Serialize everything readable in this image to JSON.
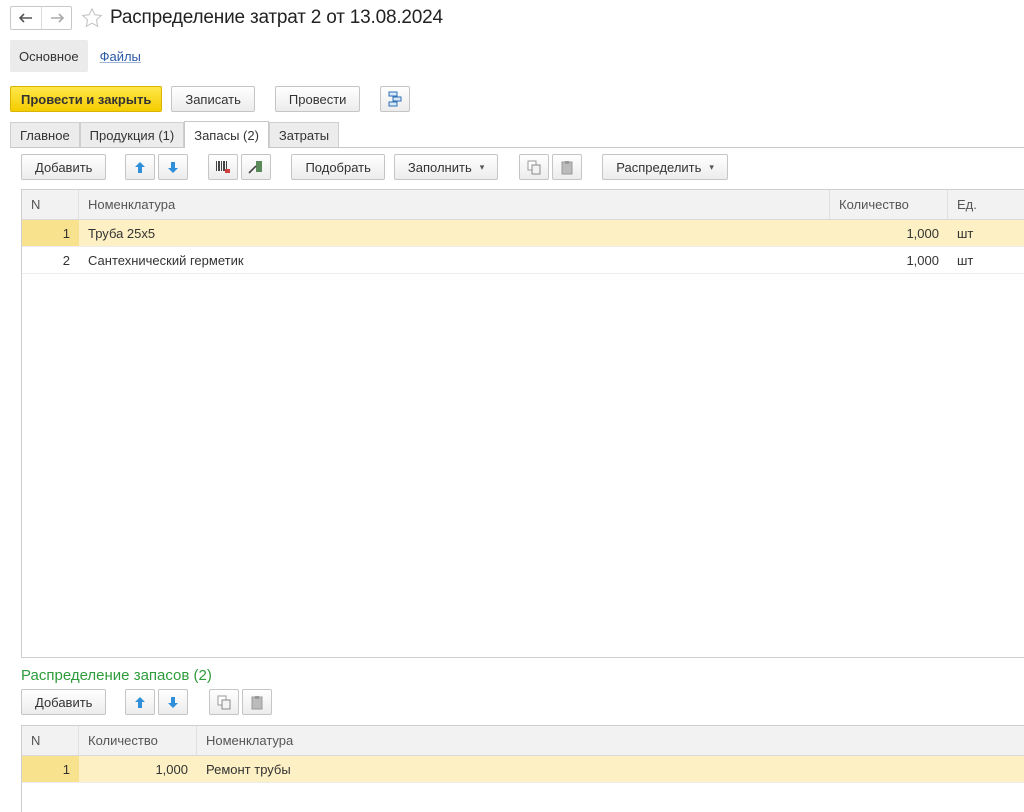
{
  "header": {
    "back_icon": "arrow-left",
    "forward_icon": "arrow-right",
    "favorite_icon": "star-outline",
    "title": "Распределение затрат 2 от 13.08.2024"
  },
  "sections": {
    "main": "Основное",
    "files": "Файлы"
  },
  "toolbar": {
    "post_close": "Провести и закрыть",
    "save": "Записать",
    "post": "Провести",
    "structure_icon": "document-structure"
  },
  "tabs": [
    {
      "label": "Главное"
    },
    {
      "label": "Продукция (1)"
    },
    {
      "label": "Запасы (2)",
      "active": true
    },
    {
      "label": "Затраты"
    }
  ],
  "stock_toolbar": {
    "add": "Добавить",
    "move_up_icon": "arrow-up",
    "move_down_icon": "arrow-down",
    "barcode_icon": "barcode",
    "scanner_icon": "scanner",
    "pick": "Подобрать",
    "fill": "Заполнить",
    "copy_icon": "copy",
    "paste_icon": "paste",
    "distribute": "Распределить"
  },
  "stock_table": {
    "columns": [
      "N",
      "Номенклатура",
      "Количество",
      "Ед."
    ],
    "rows": [
      {
        "n": "1",
        "item": "Труба 25х5",
        "qty": "1,000",
        "unit": "шт",
        "selected": true
      },
      {
        "n": "2",
        "item": "Сантехнический герметик",
        "qty": "1,000",
        "unit": "шт"
      }
    ]
  },
  "distribution": {
    "title": "Распределение запасов (2)",
    "add": "Добавить",
    "columns": [
      "N",
      "Количество",
      "Номенклатура"
    ],
    "rows": [
      {
        "n": "1",
        "qty": "1,000",
        "item": "Ремонт трубы",
        "selected": true
      }
    ]
  },
  "colors": {
    "primary_button": "#f4cc00",
    "selected_row": "#fcf0c4",
    "section_title": "#2e9c3b",
    "link": "#2b5aa8",
    "arrow_icon": "#2f8fd8"
  }
}
